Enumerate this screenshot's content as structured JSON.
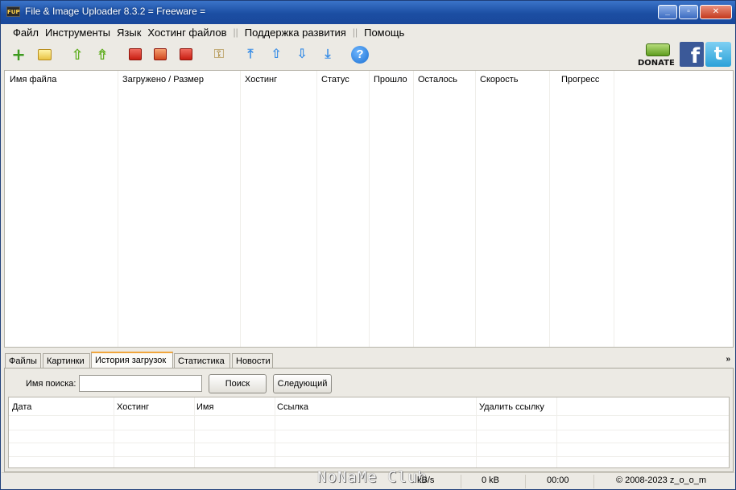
{
  "window": {
    "title": "File & Image Uploader 8.3.2  = Freeware =",
    "app_icon_text": "FUP"
  },
  "menu": [
    "Файл",
    "Инструменты",
    "Язык",
    "Хостинг файлов",
    "Поддержка развития",
    "Помощь"
  ],
  "toolbar": {
    "donate_label": "DONATE",
    "facebook_glyph": "f",
    "twitter_glyph": "t"
  },
  "columns": [
    "Имя файла",
    "Загружено / Размер",
    "Хостинг",
    "Статус",
    "Прошло",
    "Осталось",
    "Скорость",
    "Прогресс"
  ],
  "tabs": [
    "Файлы",
    "Картинки",
    "История загрузок",
    "Статистика",
    "Новости"
  ],
  "active_tab": "История загрузок",
  "history": {
    "search_label": "Имя поиска:",
    "search_value": "",
    "search_button": "Поиск",
    "next_button": "Следующий",
    "columns": [
      "Дата",
      "Хостинг",
      "Имя",
      "Ссылка",
      "Удалить ссылку"
    ]
  },
  "status": {
    "speed": "kB/s",
    "size": "0 kB",
    "time": "00:00",
    "copyright": "© 2008-2023 z_o_o_m",
    "watermark": "NoNaMe Club"
  },
  "colors": {
    "titlebar": "#1b4ea3",
    "window_bg": "#eceae4",
    "active_tab_accent": "#f0a63c"
  }
}
